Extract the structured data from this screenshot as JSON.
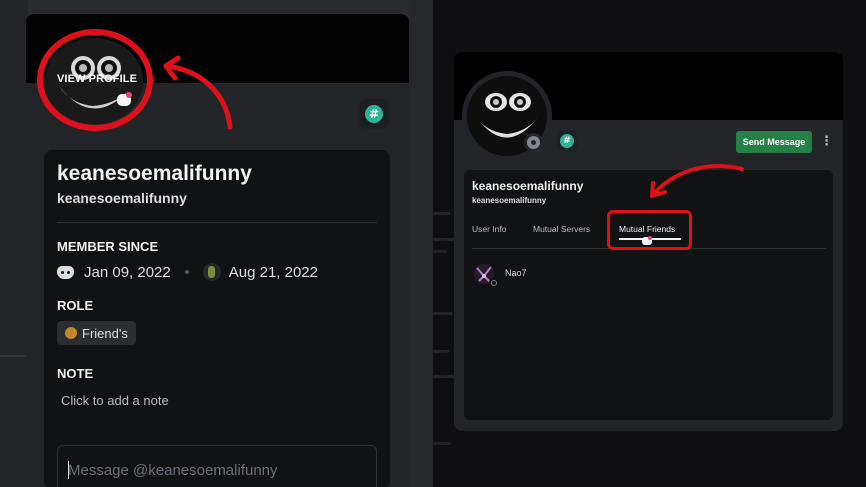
{
  "left_popout": {
    "avatar_overlay_label": "VIEW PROFILE",
    "display_name": "keanesoemalifunny",
    "username": "keanesoemalifunny",
    "badge_icon": "hash-badge-icon",
    "member_since": {
      "heading": "MEMBER SINCE",
      "discord_date": "Jan 09, 2022",
      "server_date": "Aug 21, 2022"
    },
    "role": {
      "heading": "ROLE",
      "name": "Friend's",
      "color": "#c8862a"
    },
    "note": {
      "heading": "NOTE",
      "placeholder": "Click to add a note"
    },
    "message_placeholder": "Message @keanesoemalifunny"
  },
  "right_profile": {
    "display_name": "keanesoemalifunny",
    "username": "keanesoemalifunny",
    "send_message_label": "Send Message",
    "more_icon": "⋮",
    "tabs": [
      {
        "label": "User Info",
        "active": false
      },
      {
        "label": "Mutual Servers",
        "active": false
      },
      {
        "label": "Mutual Friends",
        "active": true
      }
    ],
    "mutual_friends": [
      {
        "name": "Nao7"
      }
    ]
  },
  "colors": {
    "highlight_red": "#e0101a",
    "send_button": "#248046",
    "badge_teal": "#2fb297"
  }
}
